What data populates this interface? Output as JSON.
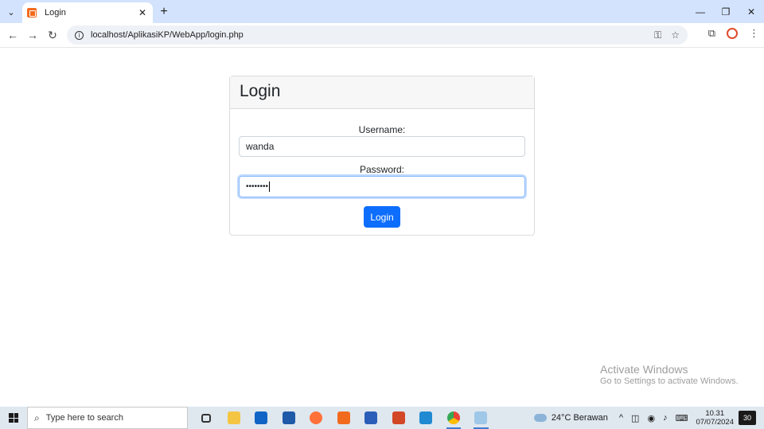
{
  "browser": {
    "tab_title": "Login",
    "url": "localhost/AplikasiKP/WebApp/login.php"
  },
  "page": {
    "card_title": "Login",
    "username_label": "Username:",
    "username_value": "wanda",
    "password_label": "Password:",
    "password_masked": "••••••••",
    "login_button": "Login",
    "accent_color": "#0d6efd"
  },
  "watermark": {
    "title": "Activate Windows",
    "subtitle": "Go to Settings to activate Windows."
  },
  "taskbar": {
    "search_placeholder": "Type here to search",
    "apps": [
      "task-view-icon",
      "file-explorer-icon",
      "mail-icon",
      "store-icon",
      "firefox-icon",
      "xampp-icon",
      "word-icon",
      "powerpoint-icon",
      "vscode-icon",
      "chrome-icon",
      "paint-icon"
    ],
    "weather_text": "24°C  Berawan",
    "time": "10.31",
    "date": "07/07/2024",
    "notification_count": "30"
  }
}
